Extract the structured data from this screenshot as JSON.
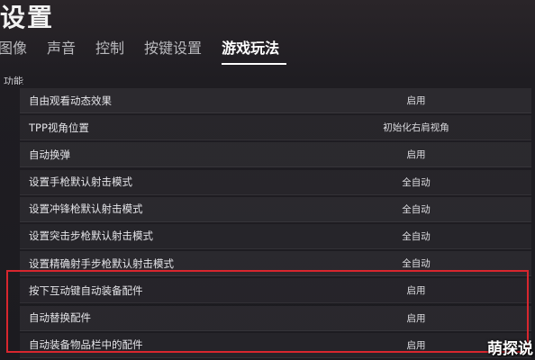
{
  "page": {
    "title": "设置",
    "section_label": "功能"
  },
  "tabs": [
    {
      "label": "图像",
      "active": false
    },
    {
      "label": "声音",
      "active": false
    },
    {
      "label": "控制",
      "active": false
    },
    {
      "label": "按键设置",
      "active": false
    },
    {
      "label": "游戏玩法",
      "active": true
    }
  ],
  "settings": [
    {
      "label": "自由观看动态效果",
      "value": "启用"
    },
    {
      "label": "TPP视角位置",
      "value": "初始化右肩视角"
    },
    {
      "label": "自动换弹",
      "value": "启用"
    },
    {
      "label": "设置手枪默认射击模式",
      "value": "全自动"
    },
    {
      "label": "设置冲锋枪默认射击模式",
      "value": "全自动"
    },
    {
      "label": "设置突击步枪默认射击模式",
      "value": "全自动"
    },
    {
      "label": "设置精确射手步枪默认射击模式",
      "value": "全自动"
    },
    {
      "label": "按下互动键自动装备配件",
      "value": "启用"
    },
    {
      "label": "自动替换配件",
      "value": "启用"
    },
    {
      "label": "自动装备物品栏中的配件",
      "value": "启用"
    }
  ],
  "watermark": "萌探说",
  "colors": {
    "highlight_border": "#d8262e",
    "background": "#1c1b20"
  }
}
